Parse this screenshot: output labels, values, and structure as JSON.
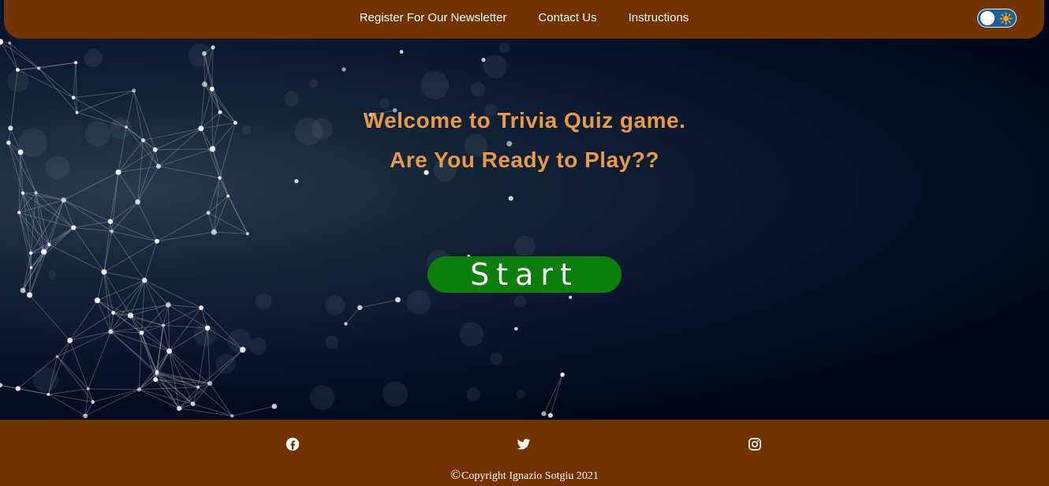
{
  "nav": {
    "links": [
      "Register For Our Newsletter",
      "Contact Us",
      "Instructions"
    ],
    "theme_toggle_icon": "sun-icon"
  },
  "hero": {
    "line1": "Welcome to Trivia Quiz game.",
    "line2": "Are You Ready to Play??",
    "start_label": "Start"
  },
  "footer": {
    "social_icons": [
      "facebook-icon",
      "twitter-icon",
      "instagram-icon"
    ],
    "copyright_symbol": "©",
    "copyright": "Copyright Ignazio Sotgiu 2021"
  },
  "colors": {
    "brand_brown": "#733300",
    "title_orange": "#e89a47",
    "start_green": "#0b7e0b",
    "background_navy": "#020a1e"
  }
}
